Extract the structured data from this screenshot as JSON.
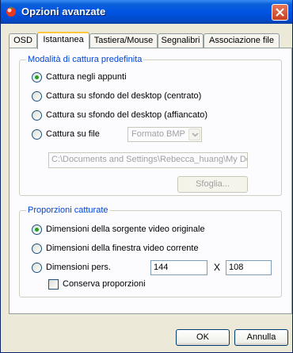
{
  "window": {
    "title": "Opzioni avanzate",
    "app_icon": "app-icon",
    "close_icon": "close-icon"
  },
  "tabs": [
    {
      "label": "OSD",
      "active": false
    },
    {
      "label": "Istantanea",
      "active": true
    },
    {
      "label": "Tastiera/Mouse",
      "active": false
    },
    {
      "label": "Segnalibri",
      "active": false
    },
    {
      "label": "Associazione file",
      "active": false
    }
  ],
  "capture_mode": {
    "title": "Modalità di cattura predefinita",
    "options": [
      {
        "label": "Cattura negli appunti",
        "selected": true
      },
      {
        "label": "Cattura su sfondo del desktop (centrato)",
        "selected": false
      },
      {
        "label": "Cattura su sfondo del desktop (affiancato)",
        "selected": false
      },
      {
        "label": "Cattura su file",
        "selected": false
      }
    ],
    "format_select": "Formato BMP",
    "path": "C:\\Documents and Settings\\Rebecca_huang\\My Doc",
    "browse_label": "Sfoglia..."
  },
  "proportions": {
    "title": "Proporzioni catturate",
    "options": [
      {
        "label": "Dimensioni della sorgente video originale",
        "selected": true
      },
      {
        "label": "Dimensioni della finestra video corrente",
        "selected": false
      },
      {
        "label": "Dimensioni pers.",
        "selected": false
      }
    ],
    "width": "144",
    "separator": "X",
    "height": "108",
    "keep_ratio_label": "Conserva proporzioni",
    "keep_ratio_checked": false
  },
  "buttons": {
    "ok": "OK",
    "cancel": "Annulla"
  }
}
